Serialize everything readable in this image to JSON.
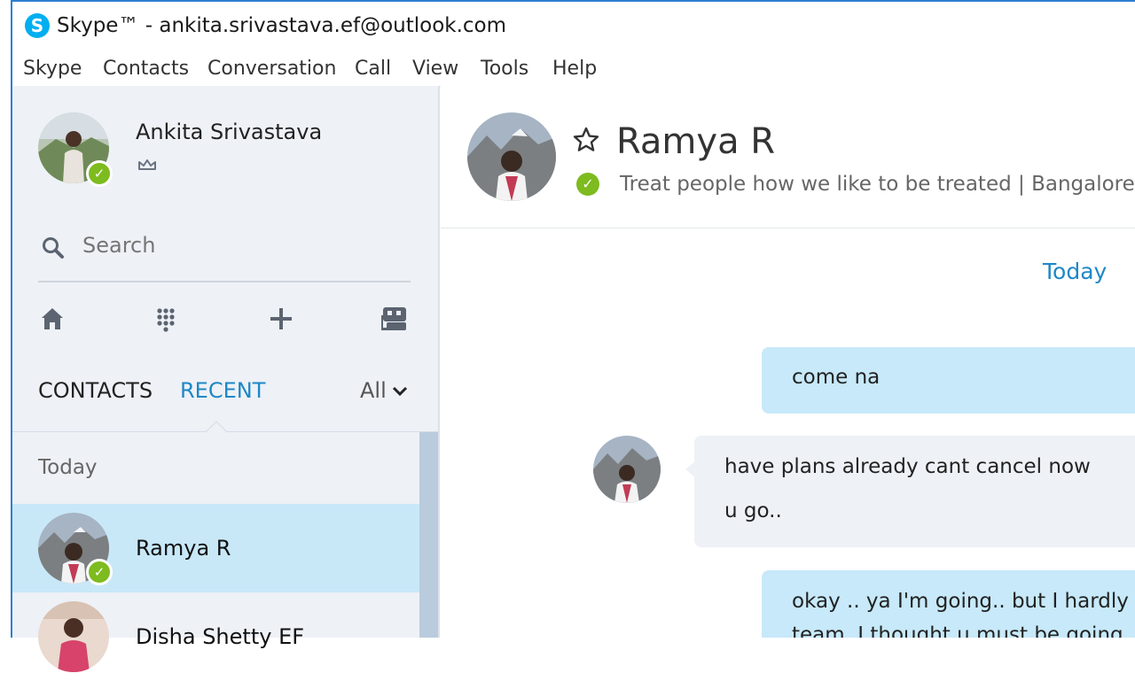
{
  "window": {
    "logo_letter": "S",
    "title": "Skype™ - ankita.srivastava.ef@outlook.com"
  },
  "menu": {
    "items": [
      "Skype",
      "Contacts",
      "Conversation",
      "Call",
      "View",
      "Tools",
      "Help"
    ]
  },
  "profile": {
    "name": "Ankita Srivastava",
    "status": "online",
    "status_color": "#7dbb1e"
  },
  "search": {
    "placeholder": "Search"
  },
  "toolbar": {
    "icons": [
      "home-icon",
      "dialpad-icon",
      "add-icon",
      "bot-icon"
    ]
  },
  "tabs": {
    "contacts_label": "CONTACTS",
    "recent_label": "RECENT",
    "active": "RECENT",
    "filter_label": "All"
  },
  "recent": {
    "group_label": "Today",
    "items": [
      {
        "name": "Ramya R",
        "status": "online",
        "selected": true
      },
      {
        "name": "Disha Shetty EF",
        "status": "",
        "selected": false
      }
    ]
  },
  "conversation": {
    "contact_name": "Ramya R",
    "mood": "Treat people how we like to be treated  |  Bangalore, Ir",
    "date_label": "Today",
    "messages": [
      {
        "direction": "outgoing",
        "lines": [
          "come na"
        ]
      },
      {
        "direction": "incoming",
        "lines": [
          "have plans already cant cancel now",
          "u go.."
        ]
      },
      {
        "direction": "outgoing",
        "lines": [
          "okay .. ya I'm going.. but I hardly k",
          "team, I thought u must be going"
        ]
      }
    ]
  },
  "colors": {
    "accent": "#1e88c6",
    "window_border": "#2f7fd1",
    "sidebar_bg": "#eef1f6",
    "selected_row": "#c8e8f8",
    "outgoing_bubble": "#c7e9f9",
    "incoming_bubble": "#eef1f6"
  }
}
